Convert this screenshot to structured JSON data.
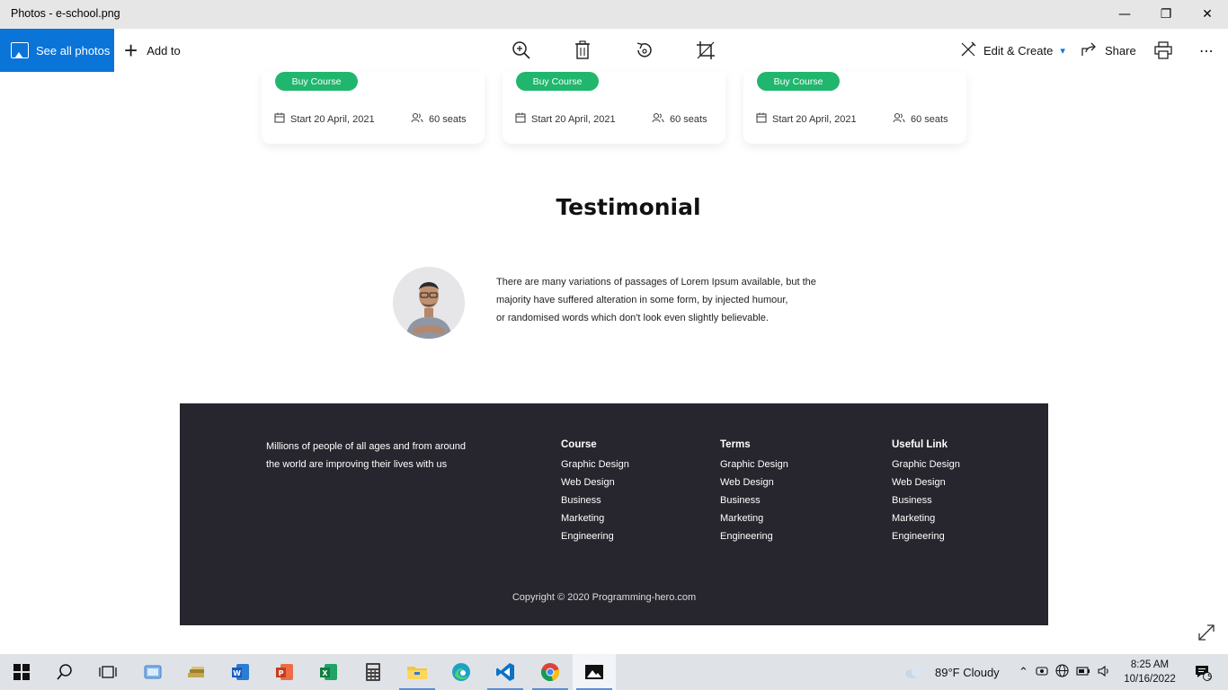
{
  "window": {
    "title": "Photos - e-school.png",
    "minimize_glyph": "—",
    "maximize_glyph": "❐",
    "close_glyph": "✕"
  },
  "toolbar": {
    "see_all_label": "See all photos",
    "add_to_label": "Add to",
    "zoom_icon": "zoom-in-icon",
    "delete_icon": "trash-icon",
    "rotate_icon": "rotate-icon",
    "crop_icon": "crop-icon",
    "edit_create_label": "Edit & Create",
    "share_label": "Share",
    "more_label": "⋯"
  },
  "courses": [
    {
      "buy_label": "Buy Course",
      "start": "Start 20  April, 2021",
      "seats": "60 seats"
    },
    {
      "buy_label": "Buy Course",
      "start": "Start 20  April, 2021",
      "seats": "60 seats"
    },
    {
      "buy_label": "Buy Course",
      "start": "Start 20  April, 2021",
      "seats": "60 seats"
    }
  ],
  "testimonial": {
    "title": "Testimonial",
    "lines": [
      "There are many variations of passages of Lorem Ipsum available, but the",
      " majority have suffered alteration in some form, by injected humour,",
      "or randomised words which don't look even slightly believable."
    ]
  },
  "footer": {
    "about_lines": [
      "Millions of people of all ages and from around",
      "the world are improving their lives with us"
    ],
    "columns": [
      {
        "heading": "Course",
        "items": [
          "Graphic Design",
          "Web Design",
          "Business",
          "Marketing",
          "Engineering"
        ]
      },
      {
        "heading": "Terms",
        "items": [
          "Graphic Design",
          "Web Design",
          "Business",
          "Marketing",
          "Engineering"
        ]
      },
      {
        "heading": "Useful Link",
        "items": [
          "Graphic Design",
          "Web Design",
          "Business",
          "Marketing",
          "Engineering"
        ]
      }
    ],
    "copyright": "Copyright © 2020 Programming-hero.com"
  },
  "taskbar": {
    "weather": "89°F  Cloudy",
    "time": "8:25 AM",
    "date": "10/16/2022",
    "notification_count": "5"
  },
  "colors": {
    "accent": "#0a74d8",
    "buy_button": "#21b66d",
    "footer_bg": "#27252d"
  }
}
